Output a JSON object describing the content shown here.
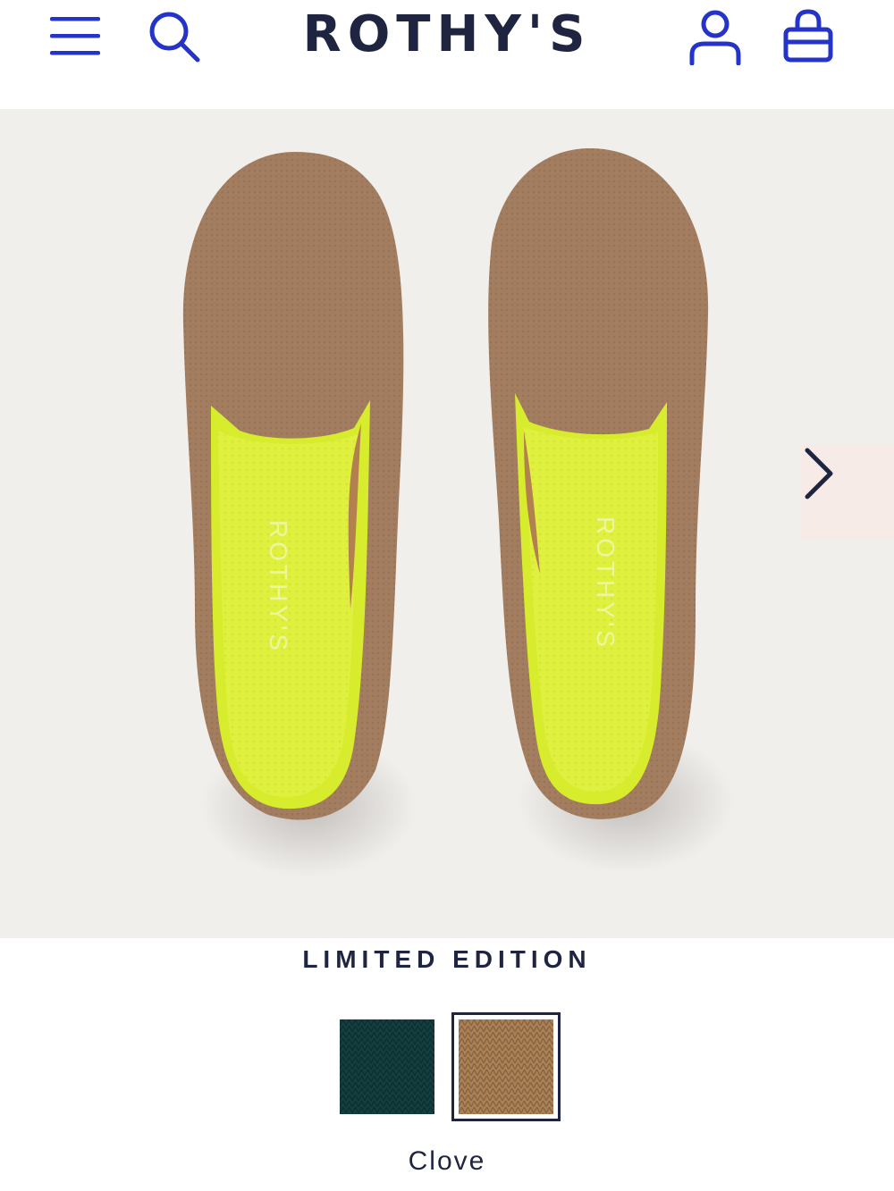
{
  "header": {
    "brand": "ROTHY'S",
    "menu_icon": "hamburger-menu-icon",
    "search_icon": "search-icon",
    "account_icon": "user-account-icon",
    "cart_icon": "shopping-bag-icon"
  },
  "product": {
    "insole_brand": "ROTHY'S",
    "badge": "LIMITED EDITION",
    "selected_color": "Clove",
    "swatches": [
      {
        "name": "Green",
        "color": "#123f40",
        "selected": false
      },
      {
        "name": "Clove",
        "color": "#a77f55",
        "selected": true
      }
    ]
  },
  "gallery": {
    "next_icon": "chevron-right-icon"
  },
  "colors": {
    "brand_navy": "#1f2541",
    "icon_blue": "#2434c9",
    "hero_bg": "#f1efec",
    "shoe_tan": "#a27c5e",
    "lining_neon": "#dff23a"
  }
}
